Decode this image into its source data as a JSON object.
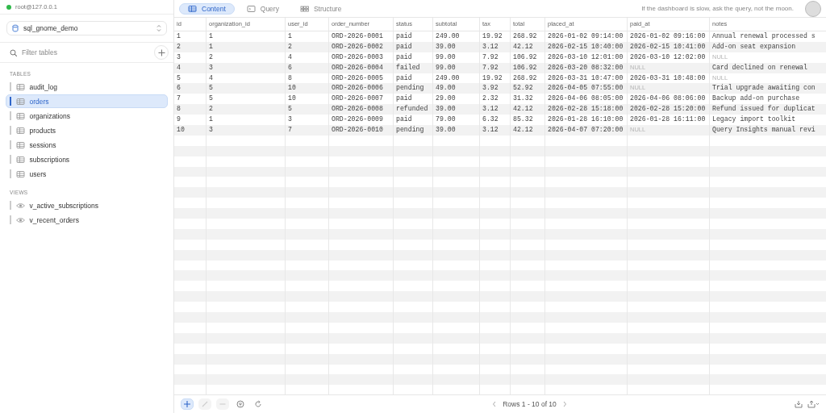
{
  "connection": {
    "address": "root@127.0.0.1",
    "online": true
  },
  "database_selector": {
    "value": "sql_gnome_demo"
  },
  "table_filter": {
    "placeholder": "Filter tables"
  },
  "sidebar": {
    "sections": [
      {
        "heading": "TABLES",
        "kind": "table",
        "items": [
          {
            "label": "audit_log",
            "selected": false
          },
          {
            "label": "orders",
            "selected": true
          },
          {
            "label": "organizations",
            "selected": false
          },
          {
            "label": "products",
            "selected": false
          },
          {
            "label": "sessions",
            "selected": false
          },
          {
            "label": "subscriptions",
            "selected": false
          },
          {
            "label": "users",
            "selected": false
          }
        ]
      },
      {
        "heading": "VIEWS",
        "kind": "view",
        "items": [
          {
            "label": "v_active_subscriptions",
            "selected": false
          },
          {
            "label": "v_recent_orders",
            "selected": false
          }
        ]
      }
    ]
  },
  "tabs": [
    {
      "label": "Content",
      "kind": "content",
      "selected": true
    },
    {
      "label": "Query",
      "kind": "query",
      "selected": false
    },
    {
      "label": "Structure",
      "kind": "structure",
      "selected": false
    }
  ],
  "tagline": "If the dashboard is slow, ask the query, not the moon.",
  "table": {
    "columns": [
      "id",
      "organization_id",
      "user_id",
      "order_number",
      "status",
      "subtotal",
      "tax",
      "total",
      "placed_at",
      "paid_at",
      "notes"
    ],
    "rows": [
      [
        "1",
        "1",
        "1",
        "ORD-2026-0001",
        "paid",
        "249.00",
        "19.92",
        "268.92",
        "2026-01-02 09:14:00",
        "2026-01-02 09:16:00",
        "Annual renewal processed s"
      ],
      [
        "2",
        "1",
        "2",
        "ORD-2026-0002",
        "paid",
        "39.00",
        "3.12",
        "42.12",
        "2026-02-15 10:40:00",
        "2026-02-15 10:41:00",
        "Add-on seat expansion"
      ],
      [
        "3",
        "2",
        "4",
        "ORD-2026-0003",
        "paid",
        "99.00",
        "7.92",
        "106.92",
        "2026-03-10 12:01:00",
        "2026-03-10 12:02:00",
        {
          "text": "NULL",
          "kind": "null"
        }
      ],
      [
        "4",
        "3",
        "6",
        "ORD-2026-0004",
        "failed",
        "99.00",
        "7.92",
        "106.92",
        "2026-03-20 08:32:00",
        {
          "text": "NULL",
          "kind": "null"
        },
        "Card declined on renewal"
      ],
      [
        "5",
        "4",
        "8",
        "ORD-2026-0005",
        "paid",
        "249.00",
        "19.92",
        "268.92",
        "2026-03-31 10:47:00",
        "2026-03-31 10:48:00",
        {
          "text": "NULL",
          "kind": "null"
        }
      ],
      [
        "6",
        "5",
        "10",
        "ORD-2026-0006",
        "pending",
        "49.00",
        "3.92",
        "52.92",
        "2026-04-05 07:55:00",
        {
          "text": "NULL",
          "kind": "null"
        },
        "Trial upgrade awaiting con"
      ],
      [
        "7",
        "5",
        "10",
        "ORD-2026-0007",
        "paid",
        "29.00",
        "2.32",
        "31.32",
        "2026-04-06 08:05:00",
        "2026-04-06 08:06:00",
        "Backup add-on purchase"
      ],
      [
        "8",
        "2",
        "5",
        "ORD-2026-0008",
        "refunded",
        "39.00",
        "3.12",
        "42.12",
        "2026-02-28 15:18:00",
        "2026-02-28 15:20:00",
        "Refund issued for duplicat"
      ],
      [
        "9",
        "1",
        "3",
        "ORD-2026-0009",
        "paid",
        "79.00",
        "6.32",
        "85.32",
        "2026-01-28 16:10:00",
        "2026-01-28 16:11:00",
        "Legacy import toolkit"
      ],
      [
        "10",
        "3",
        "7",
        "ORD-2026-0010",
        "pending",
        "39.00",
        "3.12",
        "42.12",
        "2026-04-07 07:20:00",
        {
          "text": "NULL",
          "kind": "null"
        },
        "Query Insights manual revi"
      ]
    ]
  },
  "footer": {
    "tools": [
      {
        "kind": "add",
        "disabled": false,
        "selected": true
      },
      {
        "kind": "edit",
        "disabled": true,
        "selected": false
      },
      {
        "kind": "remove",
        "disabled": true,
        "selected": false
      },
      {
        "kind": "filter",
        "disabled": false,
        "selected": false
      },
      {
        "kind": "refresh",
        "disabled": false,
        "selected": false
      }
    ],
    "pagination": "Rows 1 - 10 of 10"
  }
}
